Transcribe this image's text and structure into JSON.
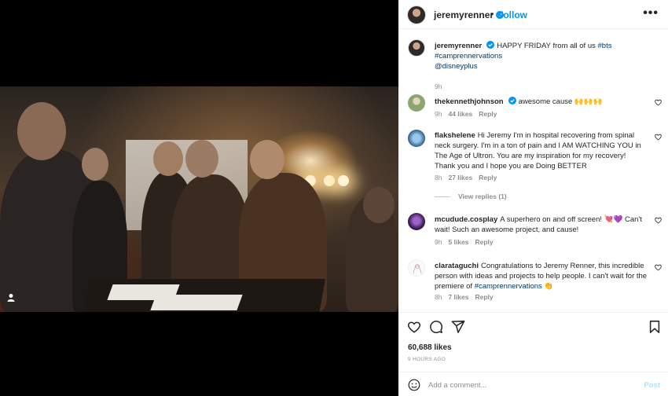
{
  "post": {
    "username": "jeremyrenner",
    "separator": "•",
    "follow_label": "Follow",
    "more_label": "•••"
  },
  "caption": {
    "username": "jeremyrenner",
    "text": "HAPPY FRIDAY from all of us",
    "tags": [
      "#bts",
      "#camprennervations"
    ],
    "mention": "@disneyplus",
    "time": "9h"
  },
  "comments": [
    {
      "username": "thekenneth johnson",
      "handle": "thekennethjohnson",
      "verified": true,
      "text": "awesome cause",
      "emoji": "🙌🙌🙌",
      "time": "9h",
      "likes": "44 likes",
      "reply": "Reply"
    },
    {
      "handle": "flakshelene",
      "verified": false,
      "text": "Hi Jeremy I'm in hospital recovering from spinal neck surgery. I'm in a ton of pain and I AM WATCHING YOU in The Age of Ultron. You are my inspiration for my recovery! Thank you and I hope you are Doing BETTER",
      "time": "8h",
      "likes": "27 likes",
      "reply": "Reply",
      "view_replies": "View replies (1)"
    },
    {
      "handle": "mcudude.cosplay",
      "verified": false,
      "text": "A superhero on and off screen!",
      "emoji": "💘💜",
      "text2": "Can't wait! Such an awesome project, and cause!",
      "time": "9h",
      "likes": "5 likes",
      "reply": "Reply"
    },
    {
      "handle": "clarataguchi",
      "verified": false,
      "text": "Congratulations to Jeremy Renner, this incredible person with ideas and projects to help people. I can't wait for the premiere of",
      "tag": "#camprennervations",
      "emoji": "👏",
      "time": "8h",
      "likes": "7 likes",
      "reply": "Reply"
    }
  ],
  "stats": {
    "likes": "60,688 likes",
    "time_ago": "9 HOURS AGO"
  },
  "comment_box": {
    "placeholder": "Add a comment...",
    "post_label": "Post"
  },
  "colors": {
    "accent": "#0095f6",
    "verified": "#0095f6",
    "link": "#00376b",
    "muted": "#8e8e8e"
  }
}
